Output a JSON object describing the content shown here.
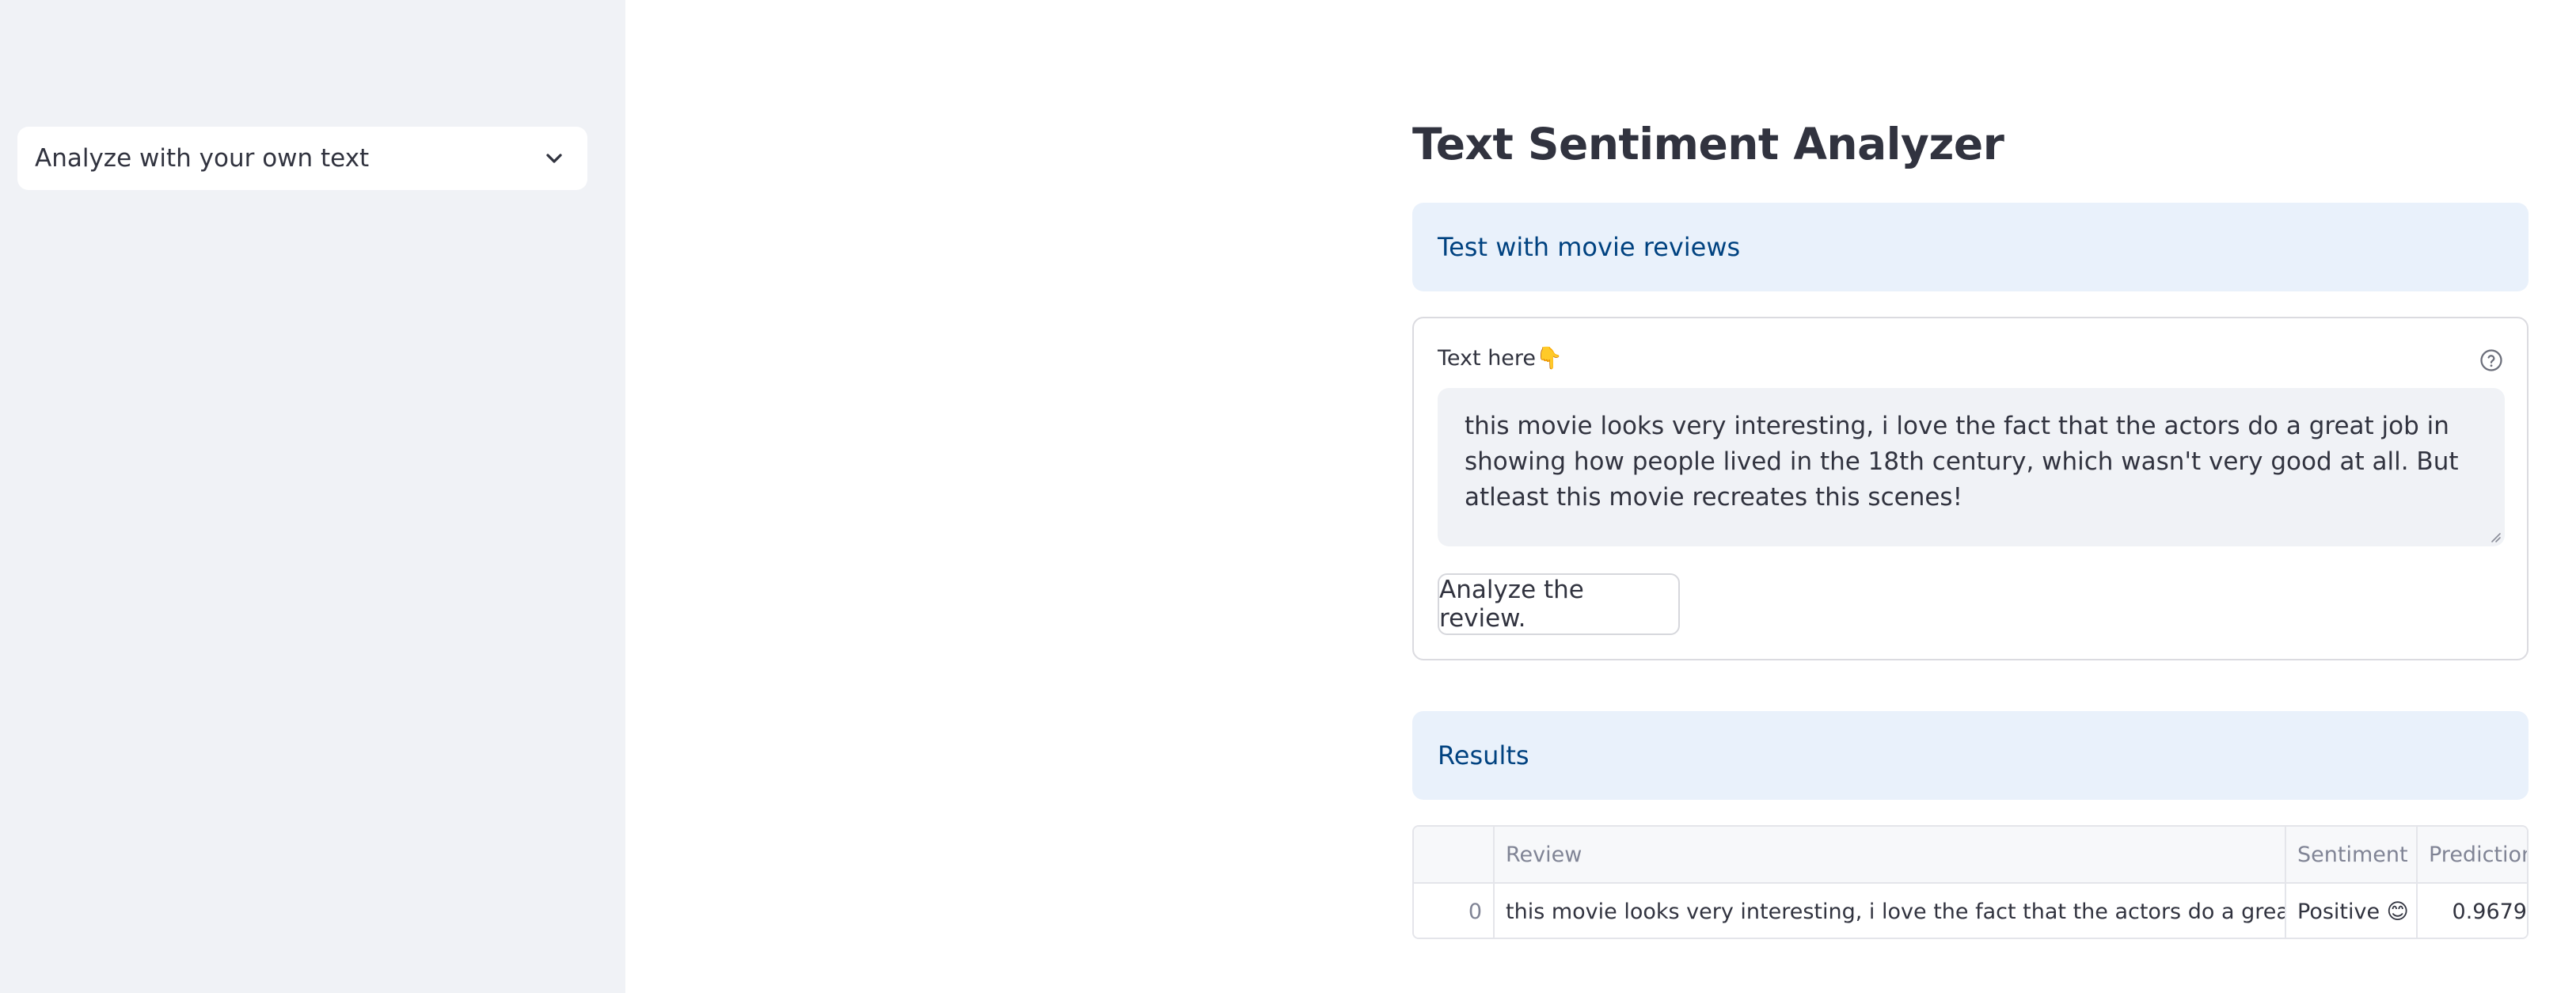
{
  "sidebar": {
    "select": {
      "value": "Analyze with your own text"
    }
  },
  "main": {
    "title": "Text Sentiment Analyzer",
    "movie_info": "Test with movie reviews",
    "form": {
      "label": "Text here👇",
      "textarea_value": "this movie looks very interesting, i love the fact that the actors do a great job in showing how people lived in the 18th century, which wasn't very good at all. But atleast this movie recreates this scenes!",
      "button_label": "Analyze the review."
    },
    "results_info": "Results",
    "table": {
      "columns": [
        "",
        "Review",
        "Sentiment",
        "Prediction"
      ],
      "rows": [
        {
          "index": "0",
          "review": "this movie looks very interesting, i love the fact that the actors do a great job in showing how people lived in the 18th century, which wasn't very good at all. But atleast this movie recreates this scenes!",
          "sentiment": "Positive 😊",
          "prediction": "0.9679"
        }
      ]
    }
  },
  "icons": {
    "select_chevron": "chevron-down-icon",
    "help": "question-circle-icon",
    "resize": "resize-handle-icon"
  },
  "colors": {
    "sidebar_bg": "#f0f2f6",
    "info_bg": "#e9f1fb",
    "info_text": "#004280",
    "text": "#31333f"
  }
}
